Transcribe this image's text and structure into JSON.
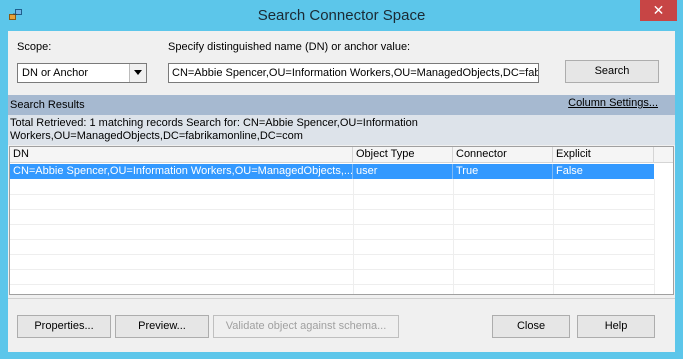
{
  "window": {
    "title": "Search Connector Space",
    "close_glyph": "✕",
    "app_icon": "connector-app-icon"
  },
  "scope": {
    "label": "Scope:",
    "selected": "DN or Anchor"
  },
  "dn": {
    "label": "Specify distinguished name (DN) or anchor value:",
    "value": "CN=Abbie Spencer,OU=Information Workers,OU=ManagedObjects,DC=fabrik"
  },
  "search_button": "Search",
  "results": {
    "header": "Search Results",
    "column_settings": "Column Settings...",
    "summary": "Total Retrieved: 1 matching records      Search for: CN=Abbie Spencer,OU=Information Workers,OU=ManagedObjects,DC=fabrikamonline,DC=com"
  },
  "grid": {
    "columns": [
      "DN",
      "Object Type",
      "Connector",
      "Explicit"
    ],
    "rows": [
      [
        "CN=Abbie Spencer,OU=Information Workers,OU=ManagedObjects,...",
        "user",
        "True",
        "False"
      ]
    ]
  },
  "buttons": {
    "properties": "Properties...",
    "preview": "Preview...",
    "validate": "Validate object against schema...",
    "close": "Close",
    "help": "Help"
  }
}
